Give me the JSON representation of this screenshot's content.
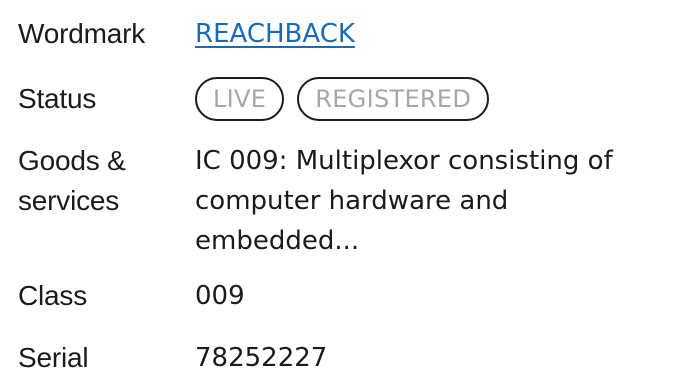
{
  "wordmark": {
    "label": "Wordmark",
    "value": "REACHBACK"
  },
  "status": {
    "label": "Status",
    "badges": [
      "LIVE",
      "REGISTERED"
    ]
  },
  "goods": {
    "label_line1": "Goods &",
    "label_line2": "services",
    "lines": [
      "IC 009: Multiplexor consisting of",
      "computer hardware and",
      "embedded..."
    ]
  },
  "class": {
    "label": "Class",
    "value": "009"
  },
  "serial": {
    "label": "Serial",
    "value": "78252227"
  }
}
